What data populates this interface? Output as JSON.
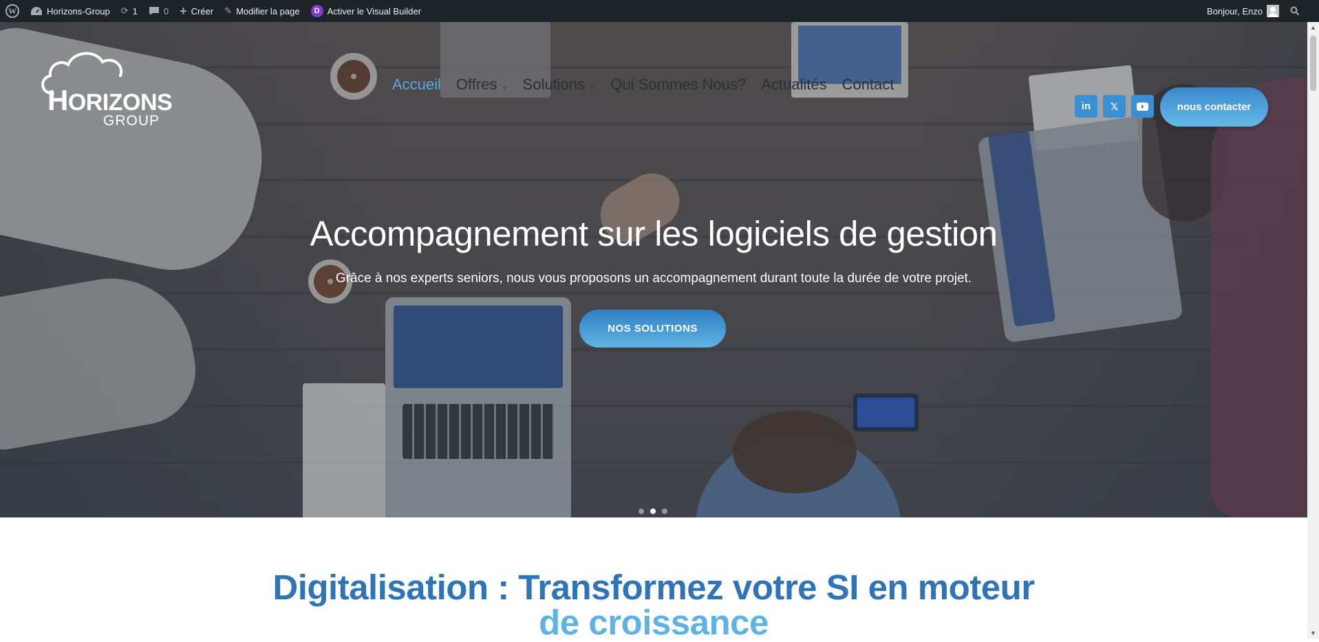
{
  "adminbar": {
    "site_name": "Horizons-Group",
    "updates_count": "1",
    "comments_count": "0",
    "create_label": "Créer",
    "edit_label": "Modifier la page",
    "visual_builder_label": "Activer le Visual Builder",
    "greeting": "Bonjour, Enzo",
    "divi_letter": "D"
  },
  "header": {
    "logo_title_initial": "H",
    "logo_title_rest": "ORIZONS",
    "logo_subtitle": "GROUP",
    "nav": [
      {
        "label": "Accueil",
        "active": true,
        "dropdown": false
      },
      {
        "label": "Offres",
        "active": false,
        "dropdown": true
      },
      {
        "label": "Solutions",
        "active": false,
        "dropdown": true
      },
      {
        "label": "Qui Sommes Nous?",
        "active": false,
        "dropdown": false
      },
      {
        "label": "Actualités",
        "active": false,
        "dropdown": false
      },
      {
        "label": "Contact",
        "active": false,
        "dropdown": false
      }
    ],
    "socials": [
      {
        "icon": "linkedin-icon",
        "glyph": "in"
      },
      {
        "icon": "x-twitter-icon",
        "glyph": "𝕏"
      },
      {
        "icon": "youtube-icon",
        "glyph": "▶"
      }
    ],
    "contact_button": "nous contacter"
  },
  "hero": {
    "title": "Accompagnement sur les logiciels de gestion",
    "subtitle": "Grâce à nos experts seniors, nous vous proposons un accompagnement durant toute la durée de votre projet.",
    "button": "NOS SOLUTIONS",
    "slides_total": 3,
    "active_slide": 2
  },
  "section": {
    "title_line1": "Digitalisation : Transformez votre SI en moteur",
    "title_line2": "de croissance"
  },
  "colors": {
    "admin_bg": "#1d2327",
    "accent_blue": "#2f74b7",
    "accent_light": "#5fb3e2",
    "nav_active": "#5aa9dd",
    "social_bg": "#3b8fd3"
  }
}
